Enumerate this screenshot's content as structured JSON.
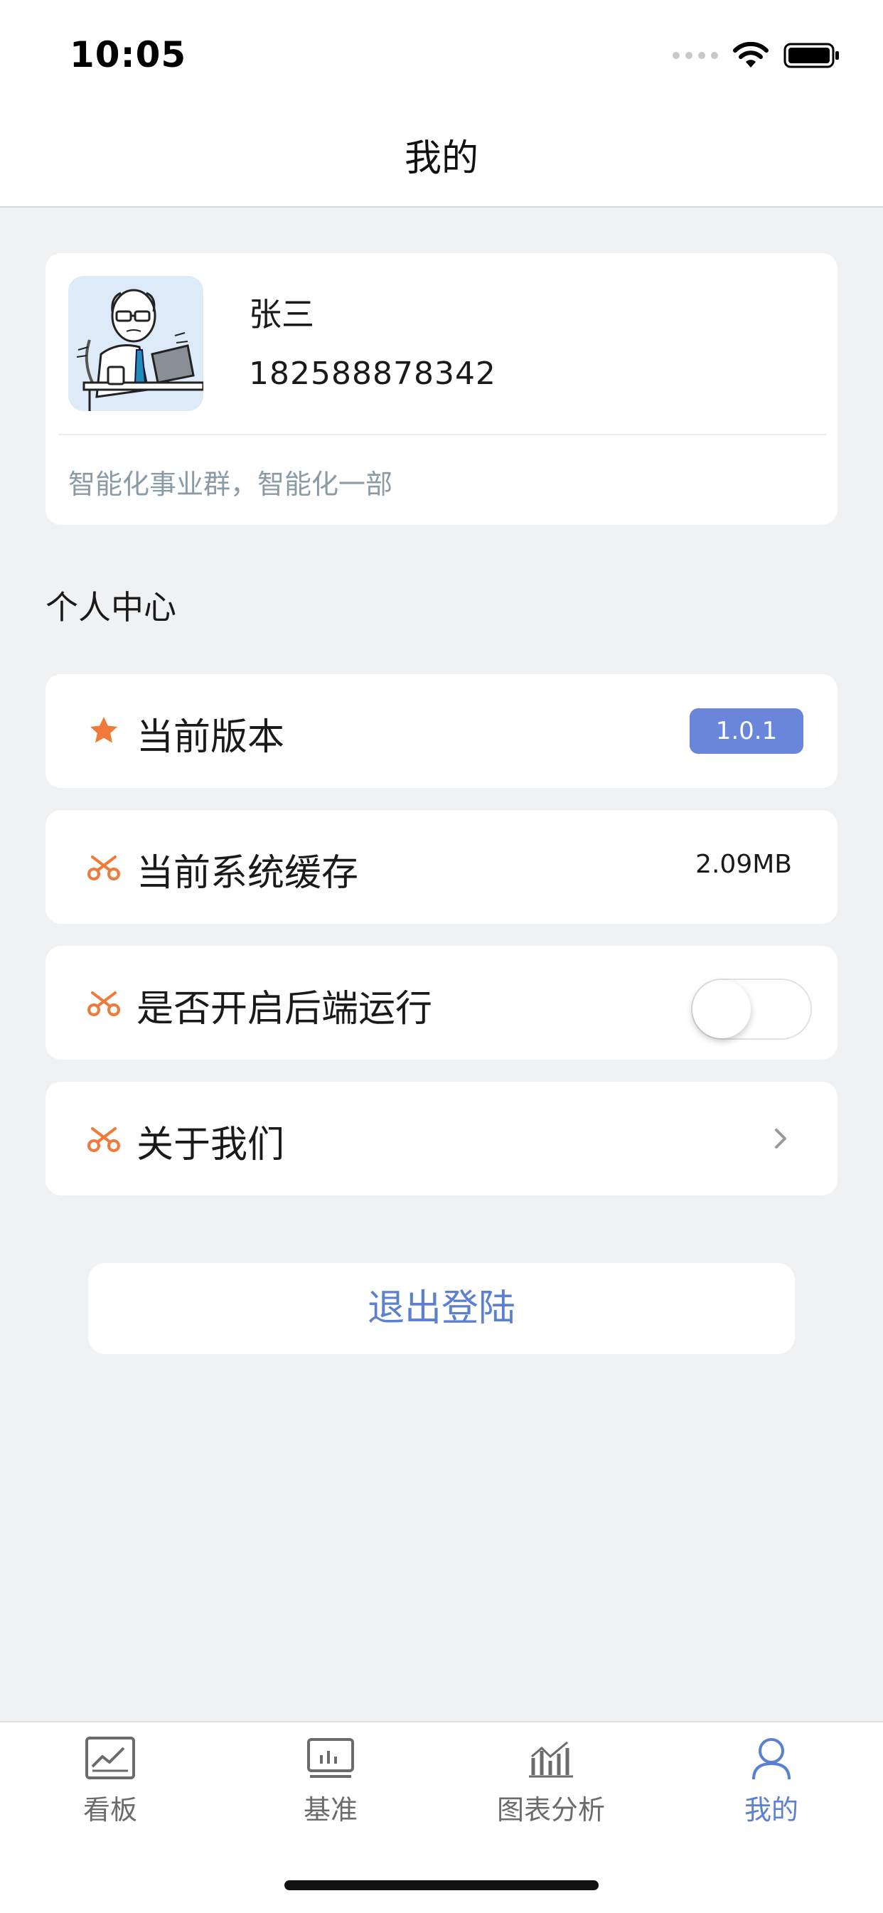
{
  "status_bar": {
    "time": "10:05"
  },
  "nav": {
    "title": "我的"
  },
  "profile": {
    "name": "张三",
    "phone": "182588878342",
    "department": "智能化事业群，智能化一部"
  },
  "section": {
    "title": "个人中心"
  },
  "settings": {
    "version": {
      "label": "当前版本",
      "value": "1.0.1",
      "icon": "star-icon"
    },
    "cache": {
      "label": "当前系统缓存",
      "value": "2.09MB",
      "icon": "scissors-icon"
    },
    "background": {
      "label": "是否开启后端运行",
      "enabled": false,
      "icon": "scissors-icon"
    },
    "about": {
      "label": "关于我们",
      "icon": "scissors-icon"
    }
  },
  "logout": {
    "label": "退出登陆"
  },
  "tabs": [
    {
      "label": "看板",
      "icon": "dashboard-chart-icon",
      "active": false
    },
    {
      "label": "基准",
      "icon": "bar-chart-monitor-icon",
      "active": false
    },
    {
      "label": "图表分析",
      "icon": "analytics-chart-icon",
      "active": false
    },
    {
      "label": "我的",
      "icon": "user-icon",
      "active": true
    }
  ],
  "colors": {
    "accent": "#5b7fd1",
    "badge": "#6a86db",
    "icon_orange": "#f07a3a",
    "background": "#f0f1f3"
  }
}
